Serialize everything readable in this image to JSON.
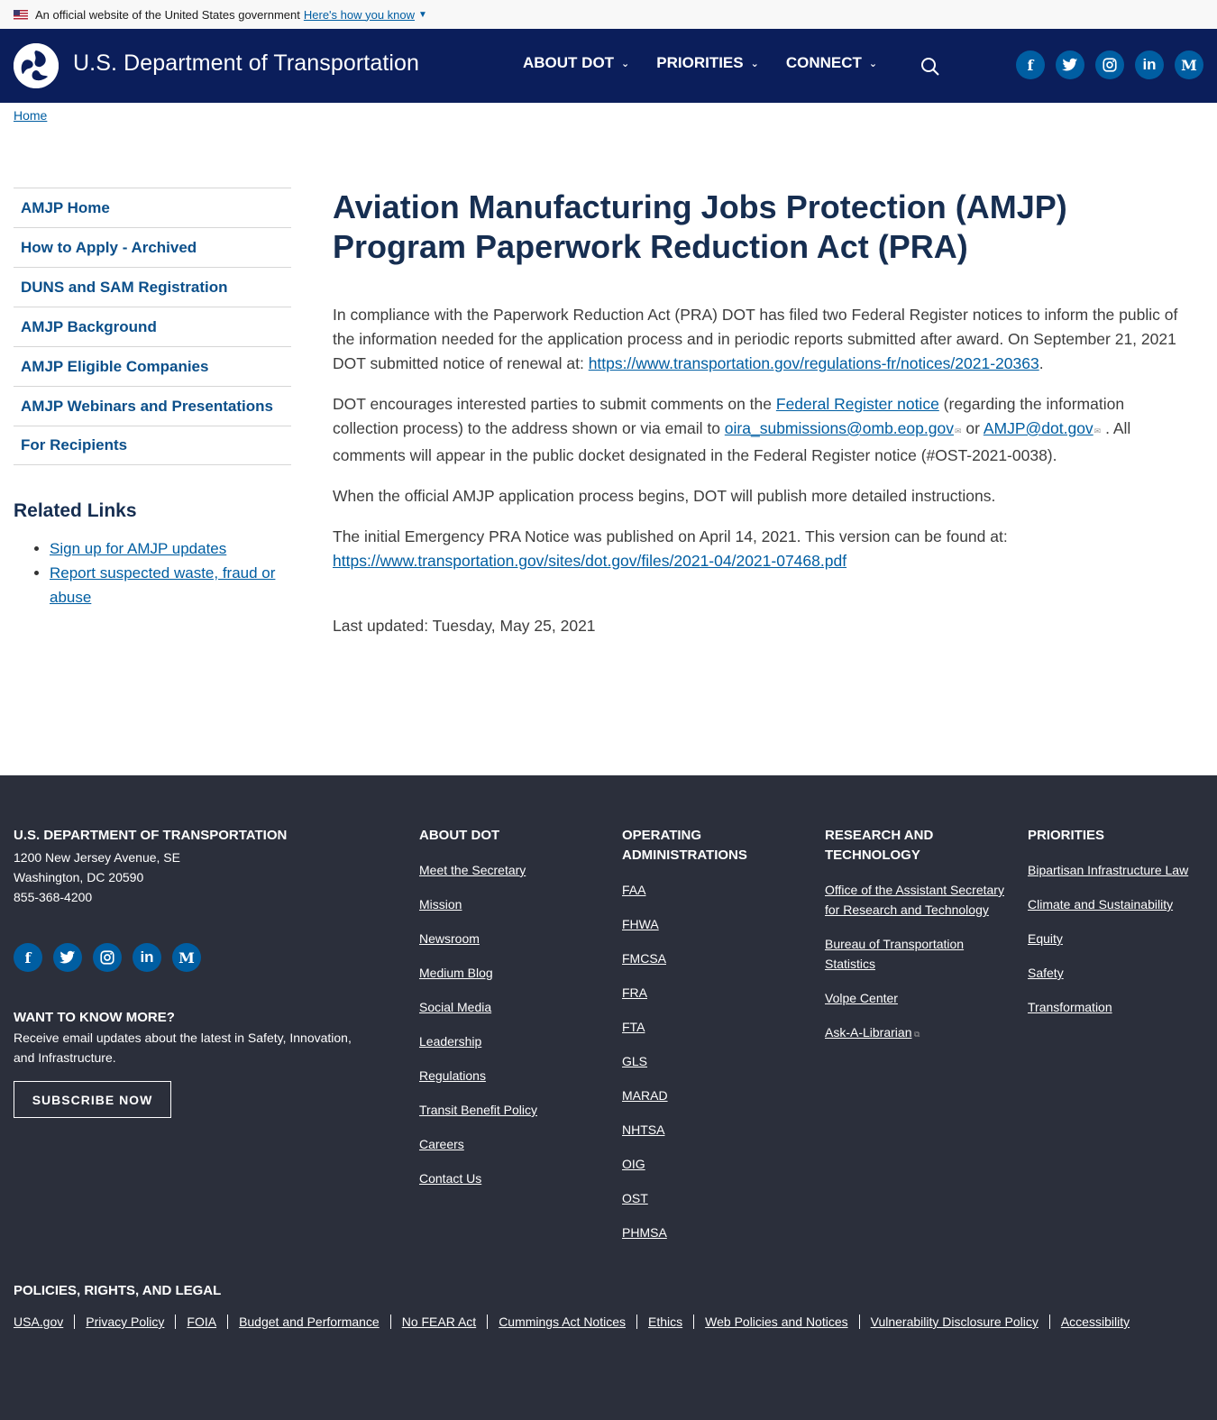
{
  "gov_banner": {
    "text": "An official website of the United States government",
    "link": "Here's how you know"
  },
  "header": {
    "site_title": "U.S. Department of Transportation",
    "nav": [
      {
        "label": "ABOUT DOT"
      },
      {
        "label": "PRIORITIES"
      },
      {
        "label": "CONNECT"
      }
    ]
  },
  "breadcrumb": {
    "home": "Home"
  },
  "sidebar": {
    "items": [
      {
        "label": "AMJP Home"
      },
      {
        "label": "How to Apply - Archived"
      },
      {
        "label": "DUNS and SAM Registration"
      },
      {
        "label": "AMJP Background"
      },
      {
        "label": "AMJP Eligible Companies"
      },
      {
        "label": "AMJP Webinars and Presentations"
      },
      {
        "label": "For Recipients"
      }
    ],
    "related_title": "Related Links",
    "related_links": [
      {
        "label": "Sign up for AMJP updates"
      },
      {
        "label": "Report suspected waste, fraud or abuse"
      }
    ]
  },
  "main": {
    "title": "Aviation Manufacturing Jobs Protection (AMJP) Program Paperwork Reduction Act (PRA)",
    "p1_text": "In compliance with the Paperwork Reduction Act (PRA) DOT has filed two Federal Register notices to inform the public of the information needed for the application process and in periodic reports submitted after award. On September 21, 2021 DOT submitted notice of renewal at: ",
    "p1_link": "https://www.transportation.gov/regulations-fr/notices/2021-20363",
    "p1_end": ".",
    "p2_a": "DOT encourages interested parties to submit comments on the ",
    "p2_link1": "Federal Register notice",
    "p2_b": " (regarding the information collection process) to the address shown or via email to ",
    "p2_link2": "oira_submissions@omb.eop.gov",
    "p2_c": " or ",
    "p2_link3": "AMJP@dot.gov",
    "p2_d": " .  All comments will appear in the public docket designated in the Federal Register notice (#OST-2021-0038).",
    "p3": "When the official AMJP application process begins, DOT will publish more detailed instructions.",
    "p4_text": "The initial Emergency PRA Notice was published on April 14, 2021. This version can be found at: ",
    "p4_link": "https://www.transportation.gov/sites/dot.gov/files/2021-04/2021-07468.pdf",
    "last_updated": "Last updated: Tuesday, May 25, 2021"
  },
  "footer": {
    "org_title": "U.S. DEPARTMENT OF TRANSPORTATION",
    "address1": "1200 New Jersey Avenue, SE",
    "address2": "Washington, DC 20590",
    "phone": "855-368-4200",
    "want_title": "WANT TO KNOW MORE?",
    "want_text": "Receive email updates about the latest in Safety, Innovation, and Infrastructure.",
    "subscribe": "SUBSCRIBE NOW",
    "about_title": "ABOUT DOT",
    "about_links": [
      "Meet the Secretary",
      "Mission",
      "Newsroom",
      "Medium Blog",
      "Social Media",
      "Leadership",
      "Regulations",
      "Transit Benefit Policy",
      "Careers",
      "Contact Us"
    ],
    "opadmin_title": "OPERATING ADMINISTRATIONS",
    "opadmin_links": [
      "FAA",
      "FHWA",
      "FMCSA",
      "FRA",
      "FTA",
      "GLS",
      "MARAD",
      "NHTSA",
      "OIG",
      "OST",
      "PHMSA"
    ],
    "research_title": "RESEARCH AND TECHNOLOGY",
    "research_links": [
      "Office of the Assistant Secretary for Research and Technology",
      "Bureau of Transportation Statistics",
      "Volpe Center",
      "Ask-A-Librarian"
    ],
    "priorities_title": "PRIORITIES",
    "priorities_links": [
      "Bipartisan Infrastructure Law",
      "Climate and Sustainability",
      "Equity",
      "Safety",
      "Transformation"
    ],
    "policies_title": "POLICIES, RIGHTS, AND LEGAL",
    "policies_links": [
      "USA.gov",
      "Privacy Policy",
      "FOIA",
      "Budget and Performance",
      "No FEAR Act",
      "Cummings Act Notices",
      "Ethics",
      "Web Policies and Notices",
      "Vulnerability Disclosure Policy",
      "Accessibility"
    ]
  },
  "colors": {
    "header_bg": "#0b1e5b",
    "accent": "#005ea2",
    "title": "#162e51",
    "footer_bg": "#2b2f3b"
  },
  "icons": [
    "us-flag-icon",
    "dot-logo-icon",
    "search-icon",
    "facebook-icon",
    "twitter-icon",
    "instagram-icon",
    "linkedin-icon",
    "medium-icon",
    "external-link-icon"
  ]
}
